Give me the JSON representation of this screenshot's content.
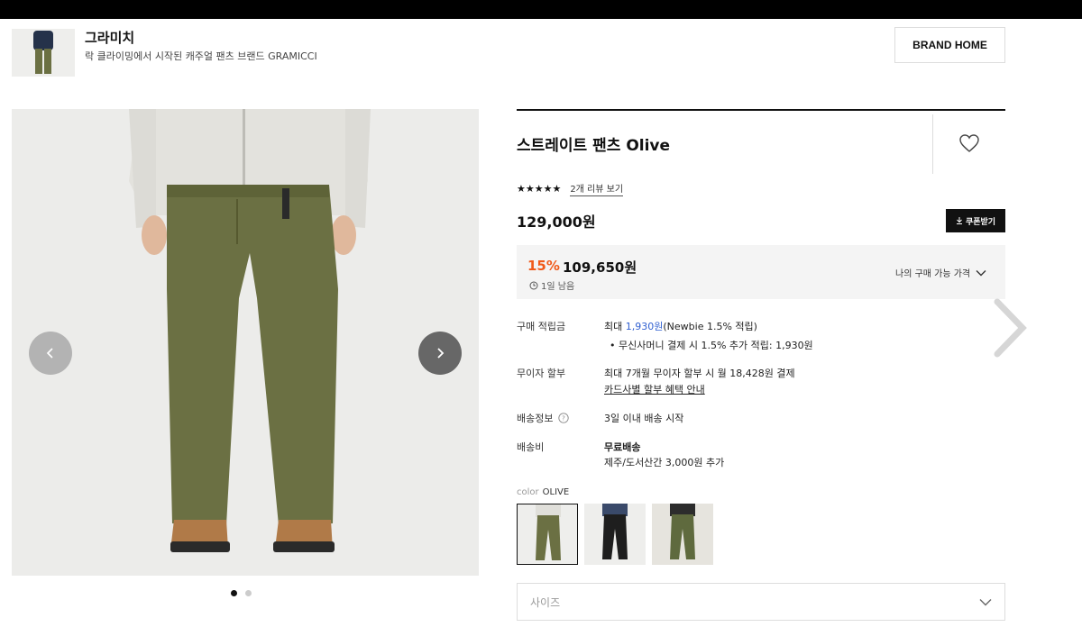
{
  "header": {
    "brand_name": "그라미치",
    "brand_desc": "락 클라이밍에서 시작된 캐주얼 팬츠 브랜드 GRAMICCI",
    "brand_home_label": "BRAND HOME"
  },
  "product": {
    "title": "스트레이트 팬츠 Olive",
    "stars": "★★★★★",
    "review_link": "2개 리뷰 보기",
    "price": "129,000원",
    "coupon_label": "쿠폰받기",
    "discount_pct": "15%",
    "sale_price": "109,650원",
    "timer": "1일 남음",
    "my_price_label": "나의 구매 가능 가격"
  },
  "details": {
    "points_label": "구매 적립금",
    "points_prefix": "최대 ",
    "points_amount": "1,930원",
    "points_suffix": "(Newbie 1.5% 적립)",
    "points_extra": "무신사머니 결제 시 1.5% 추가 적립: 1,930원",
    "installment_label": "무이자 할부",
    "installment_text": "최대 7개월 무이자 할부 시 월 18,428원 결제",
    "installment_link": "카드사별 할부 혜택 안내",
    "shipping_info_label": "배송정보",
    "shipping_info_text": "3일 이내 배송 시작",
    "shipping_fee_label": "배송비",
    "shipping_fee_text": "무료배송",
    "shipping_fee_extra": "제주/도서산간 3,000원 추가"
  },
  "options": {
    "color_label": "color",
    "color_value": "OLIVE",
    "size_placeholder": "사이즈"
  },
  "gallery": {
    "active_index": 0,
    "total": 2
  },
  "colors": {
    "accent_discount": "#f05a1a",
    "points_blue": "#2f5fd0",
    "pants_olive": "#6b7043"
  }
}
